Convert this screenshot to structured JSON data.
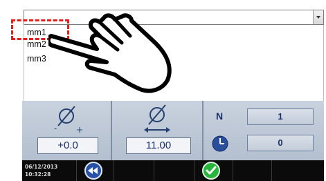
{
  "dropdown": {
    "selected_value": "",
    "options": [
      "mm1",
      "mm2",
      "mm3"
    ],
    "highlighted_option": "mm1"
  },
  "panel": {
    "offset_value": "+0.0",
    "diameter_value": "11.00",
    "n_label": "N",
    "n_value": "1",
    "timer_value": "0"
  },
  "status_bar": {
    "date": "06/12/2013",
    "time": "10:32:28"
  },
  "colors": {
    "panel_bg": "#b8c3d2",
    "value_text": "#1a3066",
    "highlight_box": "#e41d1d",
    "confirm_green": "#27b53b",
    "back_blue": "#2752a6"
  }
}
